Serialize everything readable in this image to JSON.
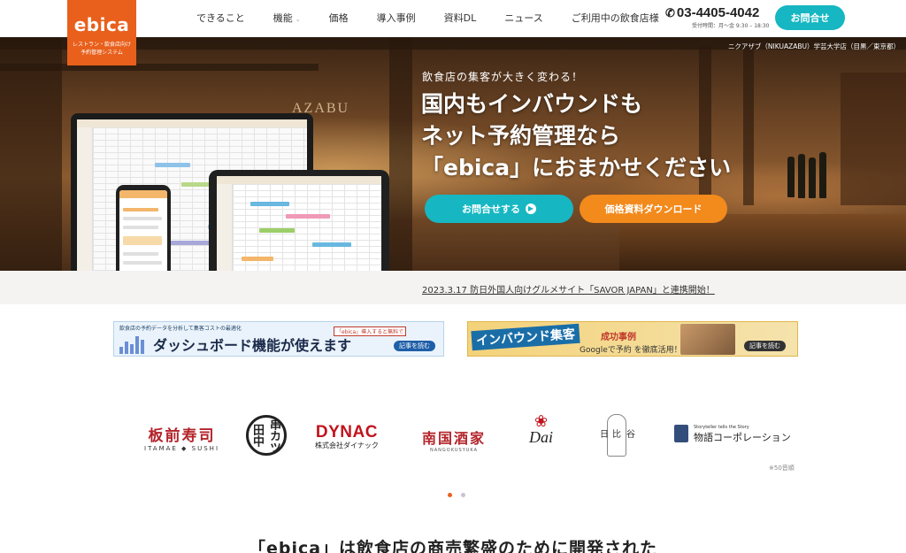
{
  "header": {
    "logo": {
      "mark": "ebica",
      "sub_line1": "レストラン・飲食店向け",
      "sub_line2": "予約管理システム"
    },
    "nav": [
      {
        "label": "できること"
      },
      {
        "label": "機能"
      },
      {
        "label": "価格"
      },
      {
        "label": "導入事例"
      },
      {
        "label": "資料DL"
      },
      {
        "label": "ニュース"
      },
      {
        "label": "ご利用中の飲食店様"
      }
    ],
    "phone": {
      "number": "03-4405-4042",
      "hours": "受付時間：月〜金 9:30 – 18:30",
      "icon": "phone-icon"
    },
    "contact_button": "お問合せ"
  },
  "hero": {
    "shop_caption": "ニクアザブ（NIKUAZABU）学芸大学店（目黒／東京都）",
    "sign": "AZABU",
    "tagline": "飲食店の集客が大きく変わる！",
    "headline_line1": "国内もインバウンドも",
    "headline_line2": "ネット予約管理なら",
    "headline_line3": "「ebica」におまかせください",
    "cta_contact": "お問合せする",
    "cta_download": "価格資料ダウンロード"
  },
  "news": {
    "text": "2023.3.17 防日外国人向けグルメサイト「SAVOR JAPAN」と連携開始！"
  },
  "banners": {
    "dashboard": {
      "top": "飲食店の予約データを分析して集客コストの最適化",
      "title": "ダッシュボード機能が使えます",
      "badge": "「ebica」導入すると無料で",
      "read": "記事を読む"
    },
    "inbound": {
      "title": "インバウンド集客",
      "subtitle": "成功事例",
      "google": "Googleで予約 を徹底活用！",
      "read": "記事を読む"
    }
  },
  "clients": {
    "itamae": {
      "main": "板前寿司",
      "sub": "ITAMAE ◆ SUSHI"
    },
    "tanaka": {
      "main": "串カツ田中"
    },
    "dynac": {
      "main": "DYNAC",
      "sub": "株式会社ダイナック"
    },
    "nangoku": {
      "main": "南国酒家",
      "sub": "NANGOKUSYUKA"
    },
    "dai": {
      "main": "Dai"
    },
    "hibiya": {
      "c1": "日",
      "c2": "比",
      "c3": "谷"
    },
    "monogatari": {
      "small": "Storyteller tells the Story",
      "main": "物語コーポレーション"
    }
  },
  "clients_note": "※50音順",
  "carousel": {
    "active_color": "#e8601c",
    "inactive_color": "#c9c3d6"
  },
  "section_heading": "「ebica」は飲食店の商売繁盛のために開発された",
  "colors": {
    "brand": "#e8601c",
    "teal": "#16b7c2",
    "orange": "#f28a1c"
  }
}
